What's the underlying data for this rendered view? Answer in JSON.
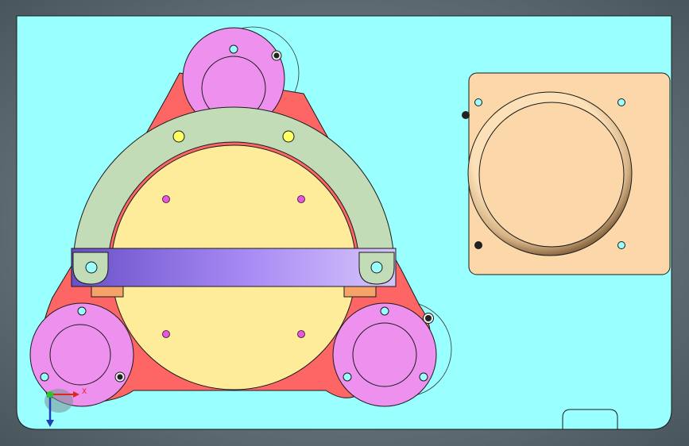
{
  "viewport": {
    "background_color": "#5d6a73",
    "plate_color": "#99ffff"
  },
  "assembly": {
    "frame_color": "#fe6666",
    "motor_color": "#ee90ee",
    "center_disc_color": "#feec9a",
    "arc_bracket_color": "#c3dcb8",
    "crossbar_gradient": [
      "#6950c8",
      "#a98bf5",
      "#d6c4fa"
    ],
    "bracket_pad_color": "#f6a36a",
    "motor_count": 3,
    "disc_hole_count": 4,
    "arc_hole_count": 2
  },
  "side_panel": {
    "panel_color": "#fcd7aa",
    "ring_color": "#c7a37b",
    "corner_hole_count": 4
  },
  "triad": {
    "x_label": "X"
  }
}
